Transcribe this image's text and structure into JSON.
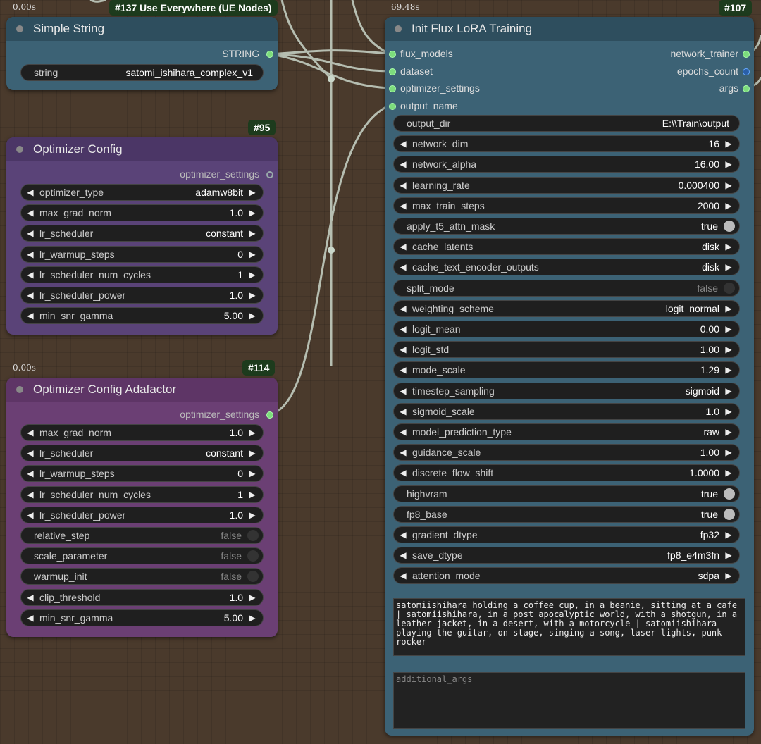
{
  "simple_string": {
    "id": "#137 Use Everywhere (UE Nodes)",
    "time": "0.00s",
    "title": "Simple String",
    "output": "STRING",
    "widget_label": "string",
    "widget_value": "satomi_ishihara_complex_v1"
  },
  "optimizer_config": {
    "id": "#95",
    "title": "Optimizer Config",
    "output": "optimizer_settings",
    "widgets": [
      {
        "label": "optimizer_type",
        "value": "adamw8bit"
      },
      {
        "label": "max_grad_norm",
        "value": "1.0"
      },
      {
        "label": "lr_scheduler",
        "value": "constant"
      },
      {
        "label": "lr_warmup_steps",
        "value": "0"
      },
      {
        "label": "lr_scheduler_num_cycles",
        "value": "1"
      },
      {
        "label": "lr_scheduler_power",
        "value": "1.0"
      },
      {
        "label": "min_snr_gamma",
        "value": "5.00"
      }
    ]
  },
  "adafactor": {
    "id": "#114",
    "time": "0.00s",
    "title": "Optimizer Config Adafactor",
    "output": "optimizer_settings",
    "widgets": [
      {
        "label": "max_grad_norm",
        "value": "1.0",
        "kind": "num"
      },
      {
        "label": "lr_scheduler",
        "value": "constant",
        "kind": "num"
      },
      {
        "label": "lr_warmup_steps",
        "value": "0",
        "kind": "num"
      },
      {
        "label": "lr_scheduler_num_cycles",
        "value": "1",
        "kind": "num"
      },
      {
        "label": "lr_scheduler_power",
        "value": "1.0",
        "kind": "num"
      },
      {
        "label": "relative_step",
        "value": "false",
        "kind": "toggle"
      },
      {
        "label": "scale_parameter",
        "value": "false",
        "kind": "toggle"
      },
      {
        "label": "warmup_init",
        "value": "false",
        "kind": "toggle"
      },
      {
        "label": "clip_threshold",
        "value": "1.0",
        "kind": "num"
      },
      {
        "label": "min_snr_gamma",
        "value": "5.00",
        "kind": "num"
      }
    ]
  },
  "init_flux": {
    "id": "#107",
    "time": "69.48s",
    "title": "Init Flux LoRA Training",
    "inputs": [
      "flux_models",
      "dataset",
      "optimizer_settings",
      "output_name"
    ],
    "outputs": [
      "network_trainer",
      "epochs_count",
      "args"
    ],
    "widgets": [
      {
        "label": "output_dir",
        "value": "E:\\\\Train\\output",
        "kind": "text"
      },
      {
        "label": "network_dim",
        "value": "16",
        "kind": "num"
      },
      {
        "label": "network_alpha",
        "value": "16.00",
        "kind": "num"
      },
      {
        "label": "learning_rate",
        "value": "0.000400",
        "kind": "num"
      },
      {
        "label": "max_train_steps",
        "value": "2000",
        "kind": "num"
      },
      {
        "label": "apply_t5_attn_mask",
        "value": "true",
        "kind": "toggle"
      },
      {
        "label": "cache_latents",
        "value": "disk",
        "kind": "num"
      },
      {
        "label": "cache_text_encoder_outputs",
        "value": "disk",
        "kind": "num"
      },
      {
        "label": "split_mode",
        "value": "false",
        "kind": "toggle"
      },
      {
        "label": "weighting_scheme",
        "value": "logit_normal",
        "kind": "num"
      },
      {
        "label": "logit_mean",
        "value": "0.00",
        "kind": "num"
      },
      {
        "label": "logit_std",
        "value": "1.00",
        "kind": "num"
      },
      {
        "label": "mode_scale",
        "value": "1.29",
        "kind": "num"
      },
      {
        "label": "timestep_sampling",
        "value": "sigmoid",
        "kind": "num"
      },
      {
        "label": "sigmoid_scale",
        "value": "1.0",
        "kind": "num"
      },
      {
        "label": "model_prediction_type",
        "value": "raw",
        "kind": "num"
      },
      {
        "label": "guidance_scale",
        "value": "1.00",
        "kind": "num"
      },
      {
        "label": "discrete_flow_shift",
        "value": "1.0000",
        "kind": "num"
      },
      {
        "label": "highvram",
        "value": "true",
        "kind": "toggle"
      },
      {
        "label": "fp8_base",
        "value": "true",
        "kind": "toggle"
      },
      {
        "label": "gradient_dtype",
        "value": "fp32",
        "kind": "num"
      },
      {
        "label": "save_dtype",
        "value": "fp8_e4m3fn",
        "kind": "num"
      },
      {
        "label": "attention_mode",
        "value": "sdpa",
        "kind": "num"
      }
    ],
    "prompt_text": "satomiishihara holding a coffee cup, in a beanie, sitting at a cafe | satomiishihara, in a post apocalyptic world, with a shotgun, in a leather jacket, in a desert, with a motorcycle | satomiishihara playing the guitar, on stage, singing a song, laser lights, punk rocker",
    "additional_args_placeholder": "additional_args"
  },
  "colors": {
    "blue_node": "#2e4e5e",
    "blue_body": "#3c6275",
    "purple_node": "#4b3666",
    "purple_body": "#5a4378",
    "magenta_node": "#5e3566",
    "magenta_body": "#6b3f74",
    "link": "#c9d6c9"
  }
}
